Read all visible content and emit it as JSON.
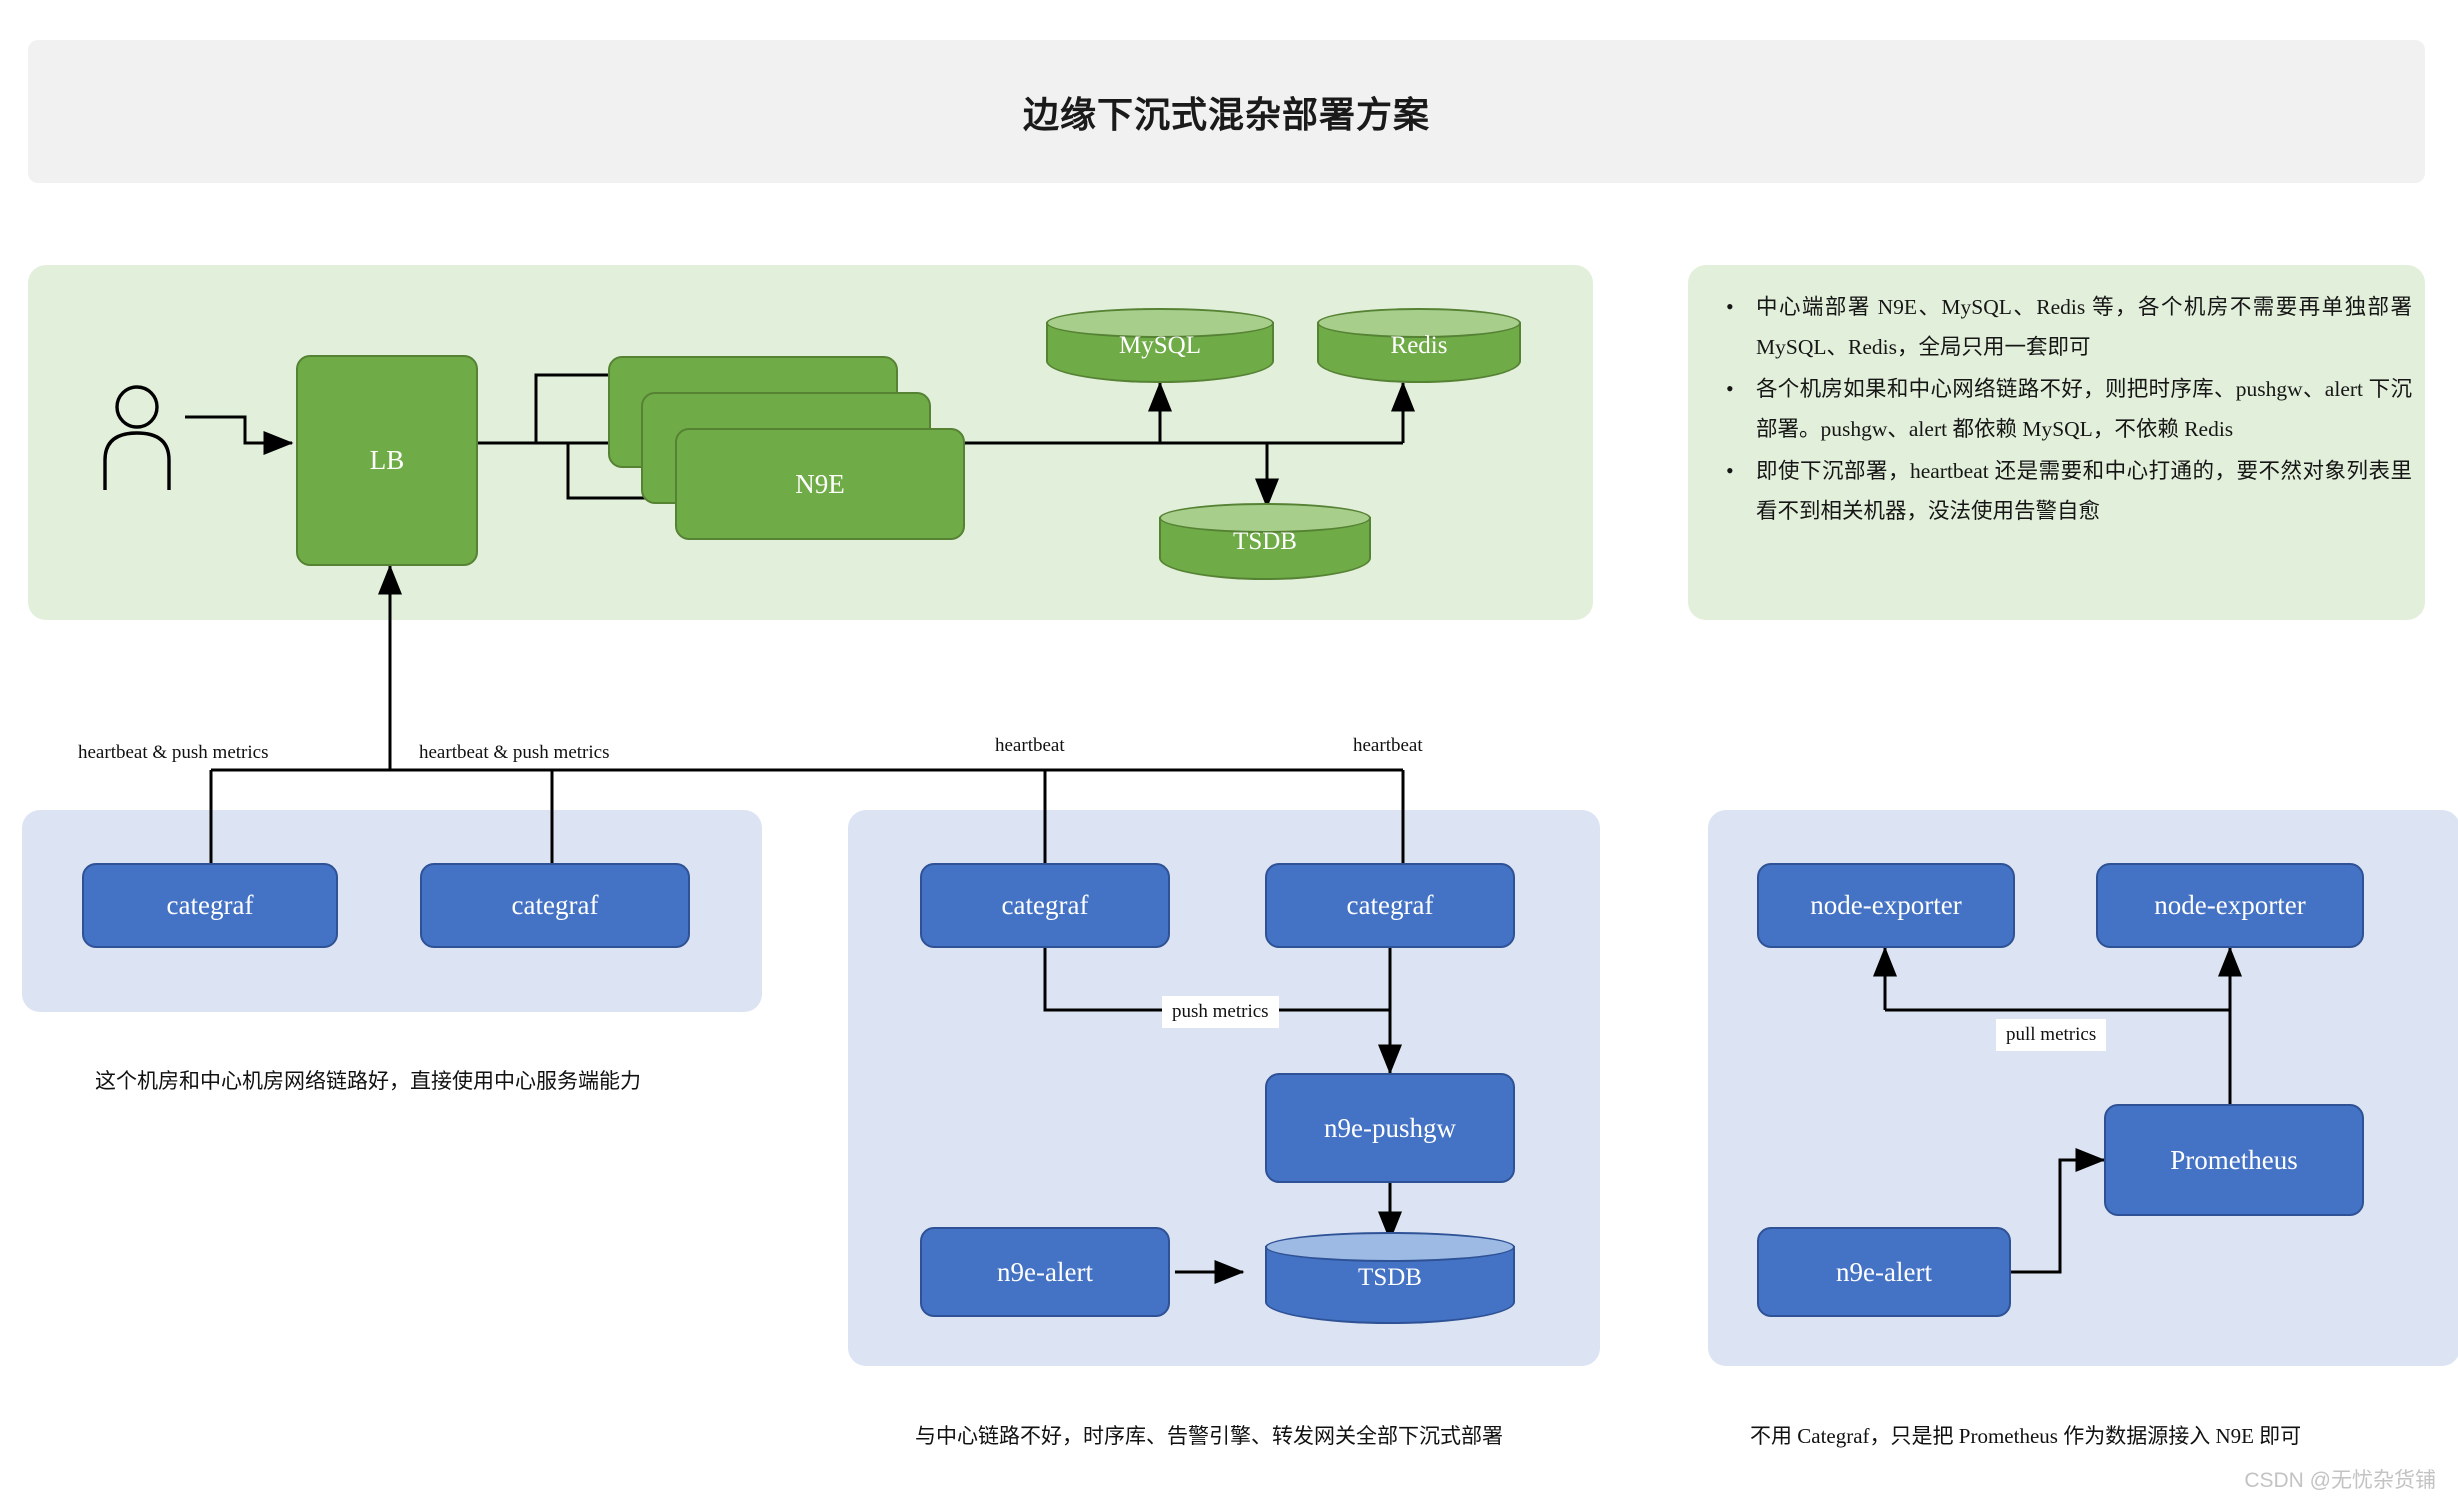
{
  "header": {
    "title": "边缘下沉式混杂部署方案"
  },
  "notes": {
    "bullets": [
      "中心端部署 N9E、MySQL、Redis 等，各个机房不需要再单独部署 MySQL、Redis，全局只用一套即可",
      "各个机房如果和中心网络链路不好，则把时序库、pushgw、alert 下沉部署。pushgw、alert 都依赖 MySQL，不依赖 Redis",
      "即使下沉部署，heartbeat 还是需要和中心打通的，要不然对象列表里看不到相关机器，没法使用告警自愈"
    ]
  },
  "center": {
    "actor": "user-actor",
    "lb": "LB",
    "n9e": "N9E",
    "mysql": "MySQL",
    "redis": "Redis",
    "tsdb": "TSDB"
  },
  "bus_labels": {
    "l1": "heartbeat & push metrics",
    "l2": "heartbeat & push metrics",
    "l3": "heartbeat",
    "l4": "heartbeat"
  },
  "dc1": {
    "nodes": [
      "categraf",
      "categraf"
    ],
    "caption": "这个机房和中心机房网络链路好，直接使用中心服务端能力"
  },
  "dc2": {
    "categraf_left": "categraf",
    "categraf_right": "categraf",
    "pushgw": "n9e-pushgw",
    "alert": "n9e-alert",
    "tsdb": "TSDB",
    "edge_label": "push metrics",
    "caption": "与中心链路不好，时序库、告警引擎、转发网关全部下沉式部署"
  },
  "dc3": {
    "exporter_left": "node-exporter",
    "exporter_right": "node-exporter",
    "prometheus": "Prometheus",
    "alert": "n9e-alert",
    "edge_label": "pull metrics",
    "caption": "不用 Categraf，只是把 Prometheus 作为数据源接入 N9E 即可"
  },
  "watermark": "CSDN @无忧杂货铺",
  "colors": {
    "green_fill": "#6fac48",
    "green_stroke": "#568234",
    "green_panel": "#e2efda",
    "blue_fill": "#4472c4",
    "blue_stroke": "#2e5295",
    "blue_panel": "#dce3f2",
    "header_bg": "#f1f1f1",
    "edge": "#000000"
  }
}
